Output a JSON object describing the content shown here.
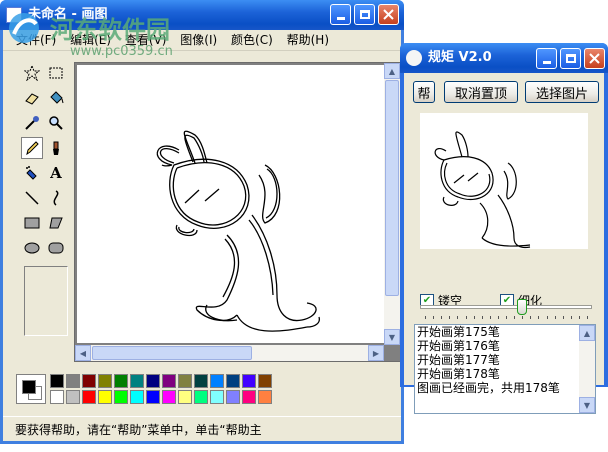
{
  "paint": {
    "title": "未命名 - 画图",
    "menu": [
      "文件(F)",
      "编辑(E)",
      "查看(V)",
      "图像(I)",
      "颜色(C)",
      "帮助(H)"
    ],
    "tools": [
      "free-select",
      "rect-select",
      "eraser",
      "fill",
      "color-picker",
      "magnifier",
      "pencil",
      "brush",
      "airbrush",
      "text",
      "line",
      "curve",
      "rectangle",
      "polygon",
      "ellipse",
      "rounded-rectangle"
    ],
    "palette_top": [
      "#000000",
      "#808080",
      "#800000",
      "#808000",
      "#008000",
      "#008080",
      "#000080",
      "#800080",
      "#808040",
      "#004040",
      "#0080ff",
      "#004080",
      "#4000ff",
      "#804000"
    ],
    "palette_bottom": [
      "#ffffff",
      "#c0c0c0",
      "#ff0000",
      "#ffff00",
      "#00ff00",
      "#00ffff",
      "#0000ff",
      "#ff00ff",
      "#ffff80",
      "#00ff80",
      "#80ffff",
      "#8080ff",
      "#ff0080",
      "#ff8040"
    ],
    "status": "要获得帮助，请在“帮助”菜单中，单击“帮助主"
  },
  "guiju": {
    "title": "规矩 V2.0",
    "help_label": "帮",
    "untop_label": "取消置顶",
    "select_label": "选择图片",
    "hollow_label": "镂空",
    "hollow_checked": true,
    "thin_label": "细化",
    "thin_checked": true,
    "slider_level": 0.6,
    "log": [
      "开始画第175笔",
      "开始画第176笔",
      "开始画第177笔",
      "开始画第178笔",
      "图画已经画完，共用178笔"
    ]
  },
  "watermark": {
    "text": "河东软件园",
    "url": "www.pc0359.cn"
  }
}
